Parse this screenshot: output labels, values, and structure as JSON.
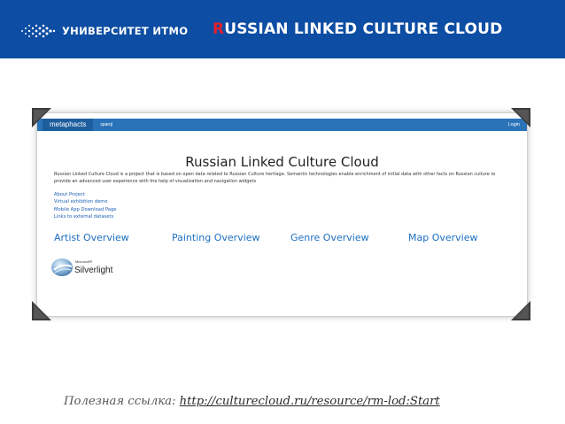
{
  "header": {
    "org_name": "УНИВЕРСИТЕТ ИТМО",
    "title_first_letter": "R",
    "title_rest": "USSIAN LINKED CULTURE CLOUD",
    "band_color": "#0d4da3",
    "accent_color": "#e2202a"
  },
  "screenshot": {
    "nav": {
      "brand": "metaphacts",
      "link": "sparql",
      "login": "Login"
    },
    "title": "Russian Linked Culture Cloud",
    "description": "Russian Linked Culture Cloud is a project that is based on open data related to Russian Culture heritage. Semantic technologies enable enrichment of initial data with other facts on Russian culture to provide an advanced user experience with the help of visualization and navigation widgets",
    "links": [
      "About Project",
      "Virtual exhibition demo",
      "Mobile App Download Page",
      "Links to external datasets"
    ],
    "overviews": [
      "Artist Overview",
      "Painting Overview",
      "Genre Overview",
      "Map Overview"
    ],
    "plugin": {
      "vendor": "Microsoft®",
      "name": "Silverlight"
    }
  },
  "footer": {
    "label": "Полезная ссылка:",
    "url": "http://culturecloud.ru/resource/rm-lod:Start"
  }
}
